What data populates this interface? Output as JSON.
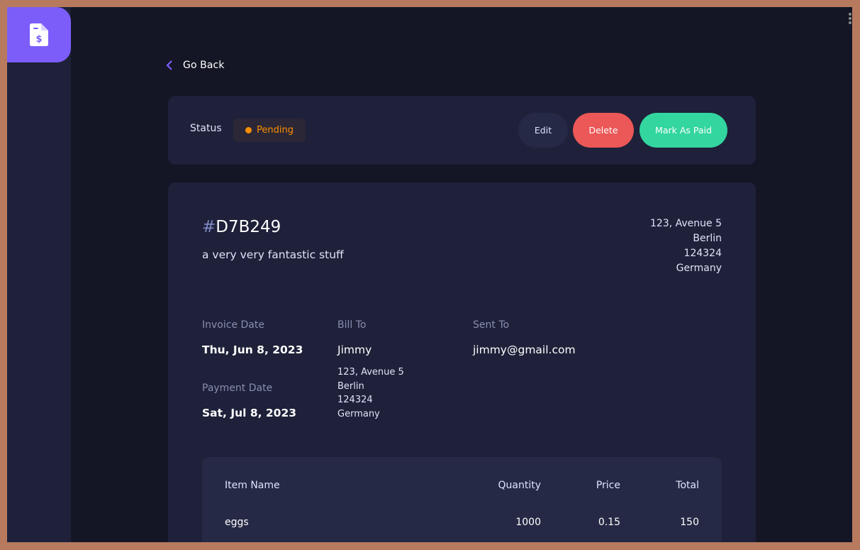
{
  "nav": {
    "back_label": "Go Back"
  },
  "status_bar": {
    "label": "Status",
    "status": "Pending",
    "status_color": "#ff8f00",
    "actions": {
      "edit": "Edit",
      "delete": "Delete",
      "mark_paid": "Mark As Paid"
    }
  },
  "invoice": {
    "id_prefix": "#",
    "id": "D7B249",
    "description": "a very very fantastic stuff",
    "sender_address": [
      "123, Avenue 5",
      "Berlin",
      "124324",
      "Germany"
    ],
    "invoice_date_label": "Invoice Date",
    "invoice_date": "Thu, Jun 8, 2023",
    "payment_date_label": "Payment Date",
    "payment_date": "Sat, Jul 8, 2023",
    "bill_to_label": "Bill To",
    "client_name": "Jimmy",
    "client_address": [
      "123, Avenue 5",
      "Berlin",
      "124324",
      "Germany"
    ],
    "sent_to_label": "Sent To",
    "client_email": "jimmy@gmail.com"
  },
  "items_table": {
    "headers": {
      "name": "Item Name",
      "quantity": "Quantity",
      "price": "Price",
      "total": "Total"
    },
    "rows": [
      {
        "name": "eggs",
        "quantity": "1000",
        "price": "0.15",
        "total": "150"
      }
    ]
  },
  "colors": {
    "accent": "#7c5dfa",
    "paid": "#33d69f",
    "danger": "#ec5757",
    "pending": "#ff8f00"
  }
}
